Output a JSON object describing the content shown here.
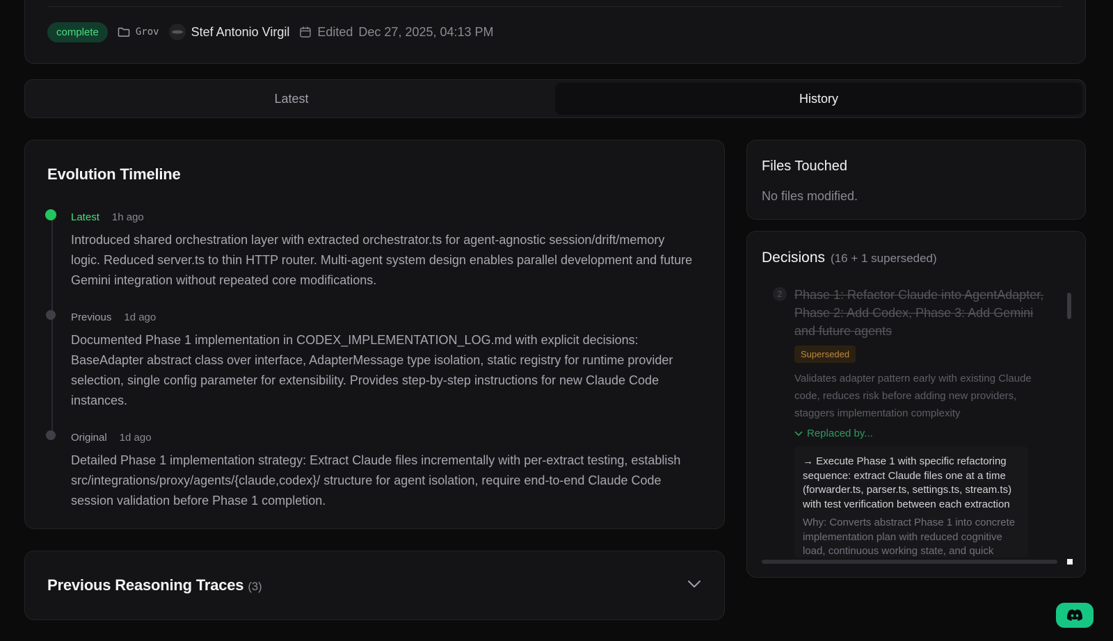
{
  "meta": {
    "status": "complete",
    "folder": "Grov",
    "author": "Stef Antonio Virgil",
    "edited_label": "Edited",
    "edited_date": "Dec 27, 2025, 04:13 PM"
  },
  "tabs": [
    {
      "label": "Latest",
      "active": false
    },
    {
      "label": "History",
      "active": true
    }
  ],
  "timeline": {
    "title": "Evolution Timeline",
    "entries": [
      {
        "label": "Latest",
        "time": "1h ago",
        "text": "Introduced shared orchestration layer with extracted orchestrator.ts for agent-agnostic session/drift/memory logic. Reduced server.ts to thin HTTP router. Multi-agent system design enables parallel development and future Gemini integration without repeated core modifications."
      },
      {
        "label": "Previous",
        "time": "1d ago",
        "text": "Documented Phase 1 implementation in CODEX_IMPLEMENTATION_LOG.md with explicit decisions: BaseAdapter abstract class over interface, AdapterMessage type isolation, static registry for runtime provider selection, single config parameter for extensibility. Provides step-by-step instructions for new Claude Code instances."
      },
      {
        "label": "Original",
        "time": "1d ago",
        "text": "Detailed Phase 1 implementation strategy: Extract Claude files incrementally with per-extract testing, establish src/integrations/proxy/agents/{claude,codex}/ structure for agent isolation, require end-to-end Claude Code session validation before Phase 1 completion."
      }
    ]
  },
  "traces": {
    "title": "Previous Reasoning Traces",
    "count": "(3)"
  },
  "files": {
    "title": "Files Touched",
    "empty": "No files modified."
  },
  "decisions": {
    "title": "Decisions",
    "count": "(16 + 1 superseded)",
    "item": {
      "number": "2",
      "title": "Phase 1: Refactor Claude into AgentAdapter, Phase 2: Add Codex, Phase 3: Add Gemini and future agents",
      "badge": "Superseded",
      "reason": "Validates adapter pattern early with existing Claude code, reduces risk before adding new providers, staggers implementation complexity",
      "replaced_by": "Replaced by...",
      "replacement_title": "→ Execute Phase 1 with specific refactoring sequence: extract Claude files one at a time (forwarder.ts, parser.ts, settings.ts, stream.ts) with test verification between each extraction",
      "replacement_why": "Why: Converts abstract Phase 1 into concrete implementation plan with reduced cognitive load, continuous working state, and quick"
    }
  },
  "colors": {
    "accent": "#22c55e",
    "background": "#0b0b0c",
    "card": "#141416",
    "superseded": "#c0873a",
    "discord": "#16c784"
  }
}
